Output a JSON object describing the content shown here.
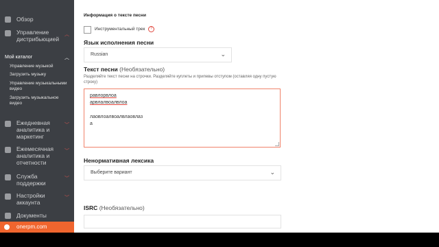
{
  "sidebar": {
    "items_top": [
      {
        "label": "Обзор"
      },
      {
        "label": "Управление дистрибьюцией"
      }
    ],
    "catalog": {
      "heading": "Мой каталог",
      "items": [
        {
          "label": "Управление музыкой"
        },
        {
          "label": "Загрузить музыку"
        },
        {
          "label": "Управление музыкальными видео"
        },
        {
          "label": "Загрузить музыкальное видео"
        }
      ]
    },
    "items_bottom": [
      {
        "label": "Ежедневная аналитика и маркетинг"
      },
      {
        "label": "Ежемесячная аналитика и отчетности"
      },
      {
        "label": "Служба поддержки"
      },
      {
        "label": "Настройки аккаунта"
      },
      {
        "label": "Документы"
      }
    ],
    "brand": "onerpm.com"
  },
  "form": {
    "info_heading": "Информация о тексте песни",
    "instrumental_label": "Инструментальный трек",
    "language": {
      "title": "Язык исполнения песни",
      "value": "Russian"
    },
    "lyrics": {
      "title": "Текст песни",
      "optional": "(Необязательно)",
      "hint": "Разделяйте текст песни на строчки. Разделяйте куплеты и припевы отступом (оставляя одну пустую строку)",
      "lines": [
        "равлорвлоа",
        "арвлалвоалвлоа",
        "лаовлоалвоалвлаовлаз",
        "а"
      ]
    },
    "explicit": {
      "title": "Ненормативная лексика",
      "placeholder": "Выберите вариант"
    },
    "isrc": {
      "title": "ISRC",
      "optional": "(Необязательно)"
    }
  },
  "colors": {
    "accent": "#f0652e",
    "sidebar_bg": "#3c3f44",
    "error": "#e0443a"
  }
}
